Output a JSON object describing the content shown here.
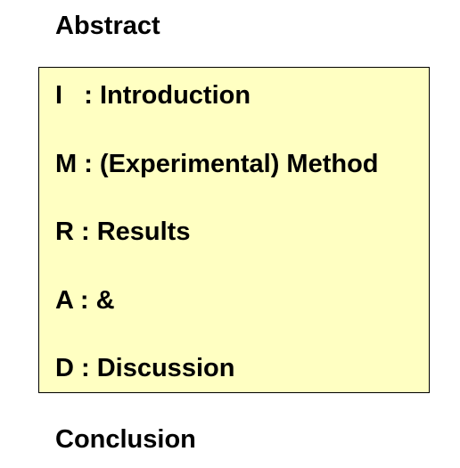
{
  "abstract_heading": "Abstract",
  "imrad_box": {
    "background_color": "#ffffc2",
    "rows": [
      "I   : Introduction",
      "M : (Experimental) Method",
      "R : Results",
      "A : &",
      "D : Discussion"
    ]
  },
  "conclusion_heading": "Conclusion"
}
